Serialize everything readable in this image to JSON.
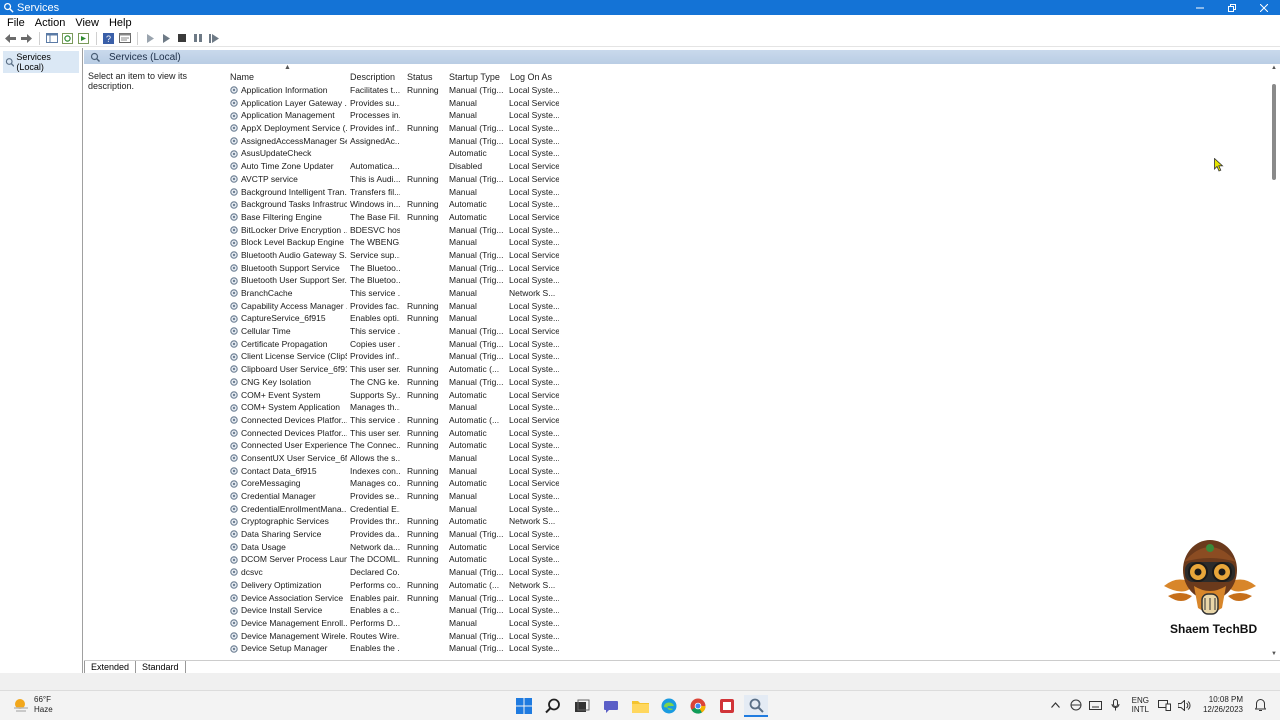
{
  "window": {
    "title": "Services"
  },
  "menu": [
    "File",
    "Action",
    "View",
    "Help"
  ],
  "tree": {
    "root_label": "Services (Local)"
  },
  "main": {
    "header_title": "Services (Local)",
    "description_prompt": "Select an item to view its description."
  },
  "columns": [
    "Name",
    "Description",
    "Status",
    "Startup Type",
    "Log On As"
  ],
  "services": [
    [
      "Application Information",
      "Facilitates t...",
      "Running",
      "Manual (Trig...",
      "Local Syste..."
    ],
    [
      "Application Layer Gateway ...",
      "Provides su...",
      "",
      "Manual",
      "Local Service"
    ],
    [
      "Application Management",
      "Processes in...",
      "",
      "Manual",
      "Local Syste..."
    ],
    [
      "AppX Deployment Service (...",
      "Provides inf...",
      "Running",
      "Manual (Trig...",
      "Local Syste..."
    ],
    [
      "AssignedAccessManager Se...",
      "AssignedAc...",
      "",
      "Manual (Trig...",
      "Local Syste..."
    ],
    [
      "AsusUpdateCheck",
      "",
      "",
      "Automatic",
      "Local Syste..."
    ],
    [
      "Auto Time Zone Updater",
      "Automatica...",
      "",
      "Disabled",
      "Local Service"
    ],
    [
      "AVCTP service",
      "This is Audi...",
      "Running",
      "Manual (Trig...",
      "Local Service"
    ],
    [
      "Background Intelligent Tran...",
      "Transfers fil...",
      "",
      "Manual",
      "Local Syste..."
    ],
    [
      "Background Tasks Infrastruc...",
      "Windows in...",
      "Running",
      "Automatic",
      "Local Syste..."
    ],
    [
      "Base Filtering Engine",
      "The Base Fil...",
      "Running",
      "Automatic",
      "Local Service"
    ],
    [
      "BitLocker Drive Encryption ...",
      "BDESVC hos...",
      "",
      "Manual (Trig...",
      "Local Syste..."
    ],
    [
      "Block Level Backup Engine ...",
      "The WBENG...",
      "",
      "Manual",
      "Local Syste..."
    ],
    [
      "Bluetooth Audio Gateway S...",
      "Service sup...",
      "",
      "Manual (Trig...",
      "Local Service"
    ],
    [
      "Bluetooth Support Service",
      "The Bluetoo...",
      "",
      "Manual (Trig...",
      "Local Service"
    ],
    [
      "Bluetooth User Support Ser...",
      "The Bluetoo...",
      "",
      "Manual (Trig...",
      "Local Syste..."
    ],
    [
      "BranchCache",
      "This service ...",
      "",
      "Manual",
      "Network S..."
    ],
    [
      "Capability Access Manager ...",
      "Provides fac...",
      "Running",
      "Manual",
      "Local Syste..."
    ],
    [
      "CaptureService_6f915",
      "Enables opti...",
      "Running",
      "Manual",
      "Local Syste..."
    ],
    [
      "Cellular Time",
      "This service ...",
      "",
      "Manual (Trig...",
      "Local Service"
    ],
    [
      "Certificate Propagation",
      "Copies user ...",
      "",
      "Manual (Trig...",
      "Local Syste..."
    ],
    [
      "Client License Service (ClipS...",
      "Provides inf...",
      "",
      "Manual (Trig...",
      "Local Syste..."
    ],
    [
      "Clipboard User Service_6f915",
      "This user ser...",
      "Running",
      "Automatic (...",
      "Local Syste..."
    ],
    [
      "CNG Key Isolation",
      "The CNG ke...",
      "Running",
      "Manual (Trig...",
      "Local Syste..."
    ],
    [
      "COM+ Event System",
      "Supports Sy...",
      "Running",
      "Automatic",
      "Local Service"
    ],
    [
      "COM+ System Application",
      "Manages th...",
      "",
      "Manual",
      "Local Syste..."
    ],
    [
      "Connected Devices Platfor...",
      "This service ...",
      "Running",
      "Automatic (...",
      "Local Service"
    ],
    [
      "Connected Devices Platfor...",
      "This user ser...",
      "Running",
      "Automatic",
      "Local Syste..."
    ],
    [
      "Connected User Experience...",
      "The Connec...",
      "Running",
      "Automatic",
      "Local Syste..."
    ],
    [
      "ConsentUX User Service_6f9...",
      "Allows the s...",
      "",
      "Manual",
      "Local Syste..."
    ],
    [
      "Contact Data_6f915",
      "Indexes con...",
      "Running",
      "Manual",
      "Local Syste..."
    ],
    [
      "CoreMessaging",
      "Manages co...",
      "Running",
      "Automatic",
      "Local Service"
    ],
    [
      "Credential Manager",
      "Provides se...",
      "Running",
      "Manual",
      "Local Syste..."
    ],
    [
      "CredentialEnrollmentMana...",
      "Credential E...",
      "",
      "Manual",
      "Local Syste..."
    ],
    [
      "Cryptographic Services",
      "Provides thr...",
      "Running",
      "Automatic",
      "Network S..."
    ],
    [
      "Data Sharing Service",
      "Provides da...",
      "Running",
      "Manual (Trig...",
      "Local Syste..."
    ],
    [
      "Data Usage",
      "Network da...",
      "Running",
      "Automatic",
      "Local Service"
    ],
    [
      "DCOM Server Process Laun...",
      "The DCOML...",
      "Running",
      "Automatic",
      "Local Syste..."
    ],
    [
      "dcsvc",
      "Declared Co...",
      "",
      "Manual (Trig...",
      "Local Syste..."
    ],
    [
      "Delivery Optimization",
      "Performs co...",
      "Running",
      "Automatic (...",
      "Network S..."
    ],
    [
      "Device Association Service",
      "Enables pair...",
      "Running",
      "Manual (Trig...",
      "Local Syste..."
    ],
    [
      "Device Install Service",
      "Enables a c...",
      "",
      "Manual (Trig...",
      "Local Syste..."
    ],
    [
      "Device Management Enroll...",
      "Performs D...",
      "",
      "Manual",
      "Local Syste..."
    ],
    [
      "Device Management Wirele...",
      "Routes Wire...",
      "",
      "Manual (Trig...",
      "Local Syste..."
    ],
    [
      "Device Setup Manager",
      "Enables the ...",
      "",
      "Manual (Trig...",
      "Local Syste..."
    ]
  ],
  "tabs": [
    "Extended",
    "Standard"
  ],
  "taskbar": {
    "temperature": "66°F",
    "weather": "Haze",
    "lang_top": "ENG",
    "lang_bottom": "INTL",
    "time": "10:08 PM",
    "date": "12/26/2023"
  },
  "watermark": {
    "text": "Shaem TechBD"
  },
  "colors": {
    "titlebar": "#1473d6",
    "header": "#c9d9ec",
    "selection": "#dbe8f5"
  }
}
